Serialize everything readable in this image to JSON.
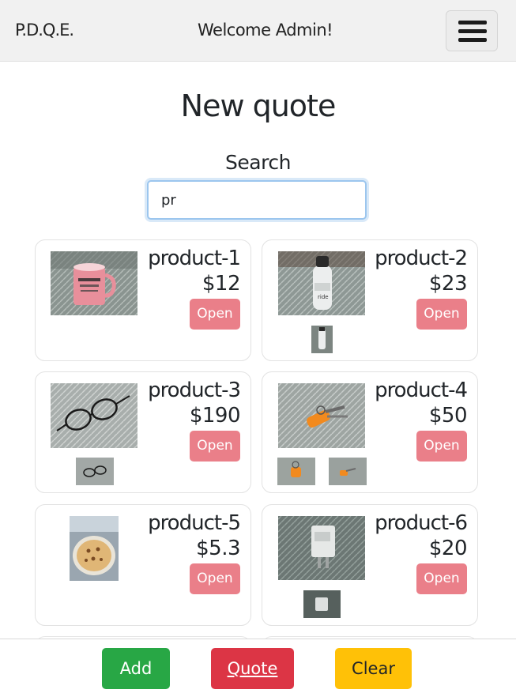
{
  "navbar": {
    "brand": "P.D.Q.E.",
    "welcome": "Welcome Admin!",
    "menu_icon": "hamburger-icon"
  },
  "page": {
    "title": "New quote"
  },
  "search": {
    "label": "Search",
    "value": "pr",
    "placeholder": ""
  },
  "products": [
    {
      "name": "product-1",
      "price": "$12",
      "open_label": "Open"
    },
    {
      "name": "product-2",
      "price": "$23",
      "open_label": "Open"
    },
    {
      "name": "product-3",
      "price": "$190",
      "open_label": "Open"
    },
    {
      "name": "product-4",
      "price": "$50",
      "open_label": "Open"
    },
    {
      "name": "product-5",
      "price": "$5.3",
      "open_label": "Open"
    },
    {
      "name": "product-6",
      "price": "$20",
      "open_label": "Open"
    }
  ],
  "actions": {
    "add_label": "Add",
    "quote_label": "Quote",
    "clear_label": "Clear"
  },
  "colors": {
    "open_button": "#ea7f89",
    "add_button": "#28a745",
    "quote_button": "#dc3545",
    "clear_button": "#ffc107"
  }
}
